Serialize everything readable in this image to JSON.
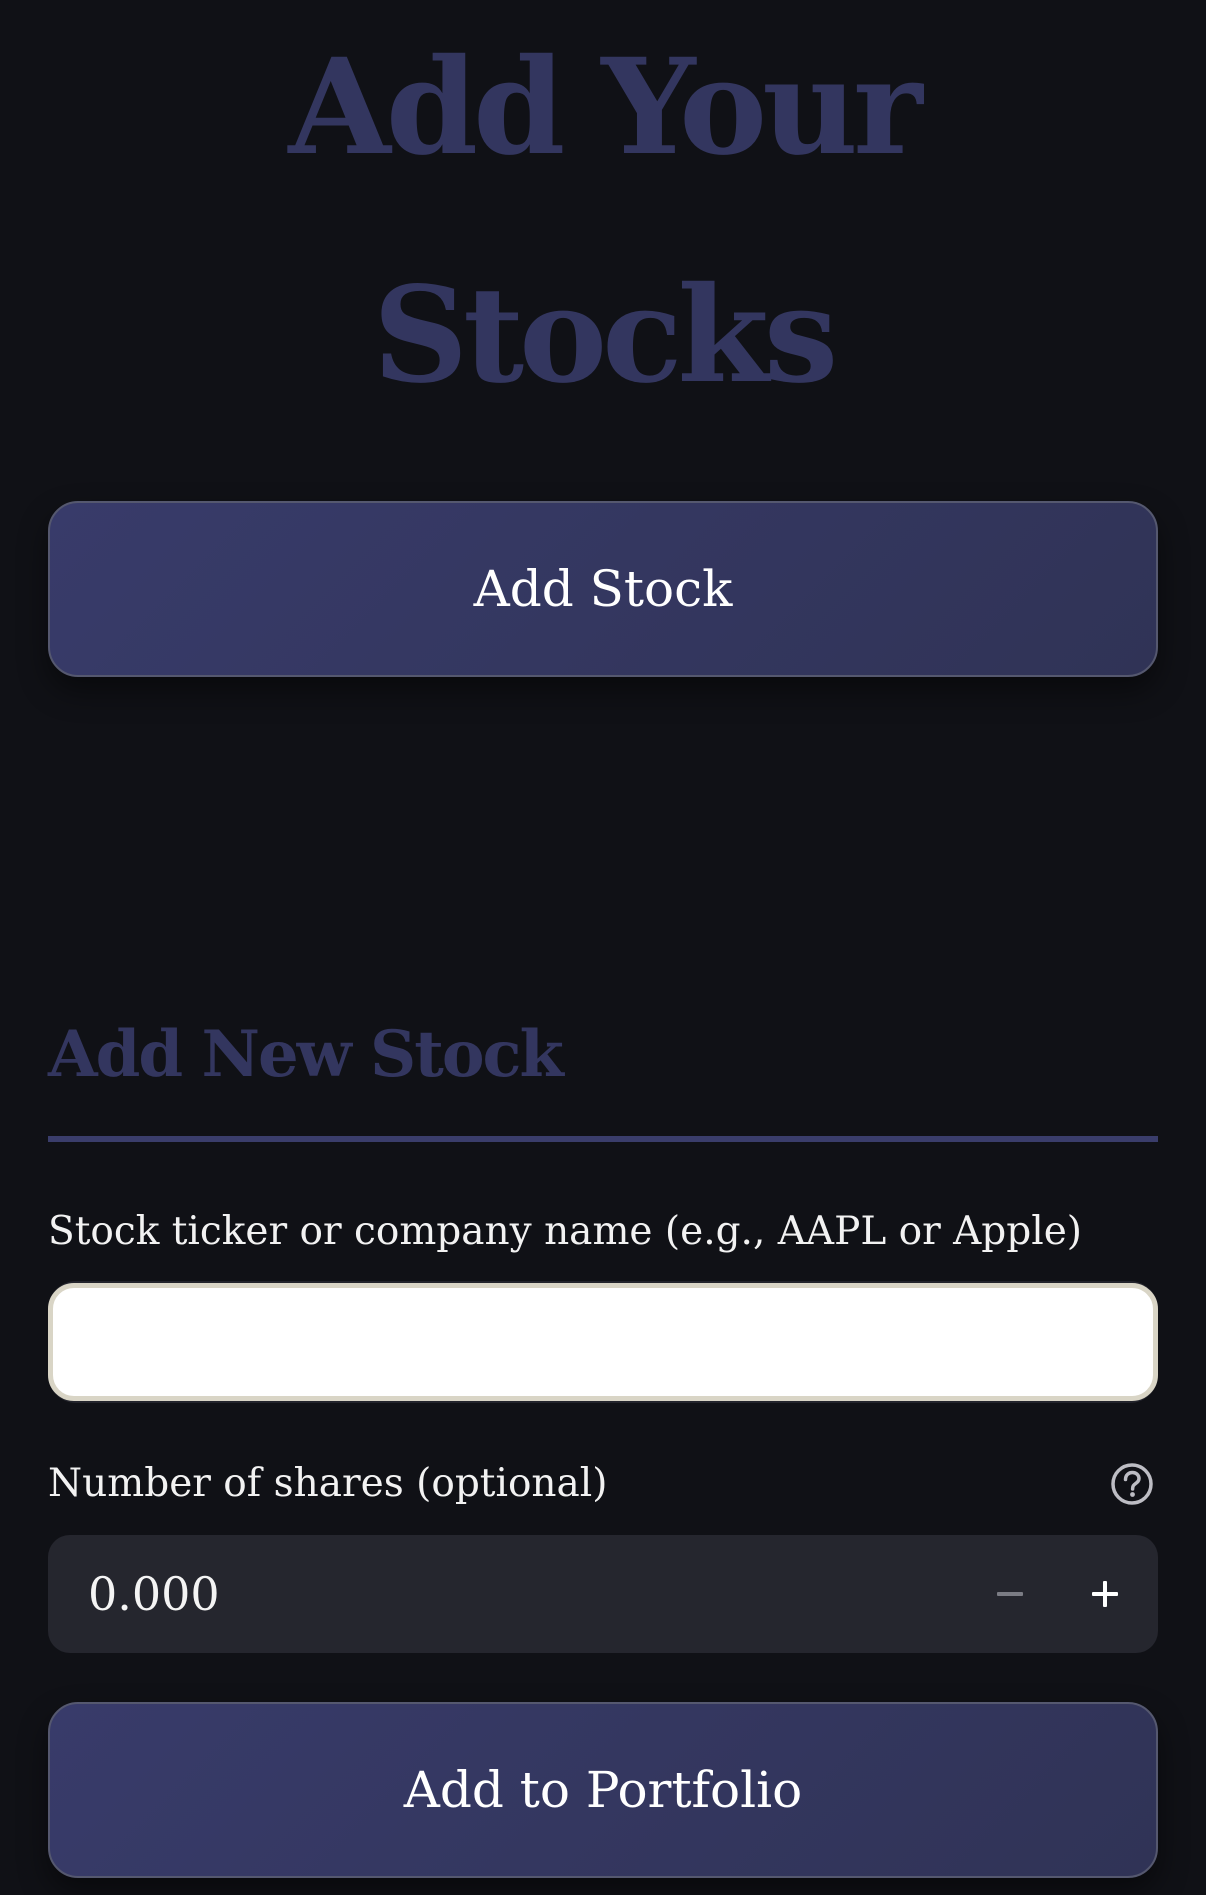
{
  "header": {
    "title_line1": "Add Your",
    "title_line2": "Stocks"
  },
  "actions": {
    "add_stock_label": "Add Stock"
  },
  "form": {
    "section_title": "Add New Stock",
    "ticker_label": "Stock ticker or company name (e.g., AAPL or Apple)",
    "ticker_value": "",
    "shares_label": "Number of shares (optional)",
    "shares_value": "0.000",
    "submit_label": "Add to Portfolio"
  },
  "icons": {
    "help": "help-circle-icon",
    "minus": "minus-icon",
    "plus": "plus-icon"
  },
  "colors": {
    "background": "#101116",
    "accent": "#33365f",
    "button": "#353863",
    "input_bg": "#25262e"
  }
}
